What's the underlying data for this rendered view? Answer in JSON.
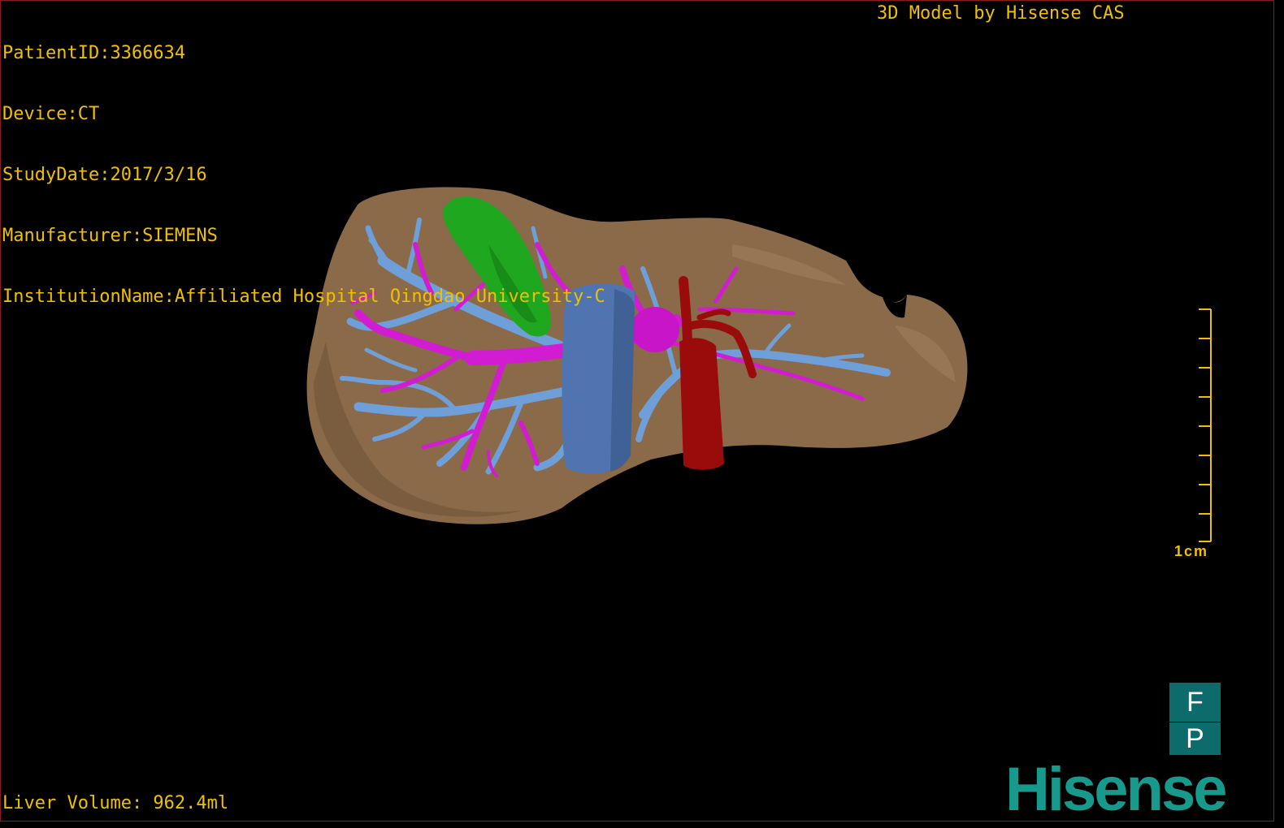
{
  "info": {
    "patient_id": "PatientID:3366634",
    "device": "Device:CT",
    "study_date": "StudyDate:2017/3/16",
    "manufacturer": "Manufacturer:SIEMENS",
    "institution": "InstitutionName:Affiliated Hospital Qingdao University-C"
  },
  "title": "3D Model by Hisense CAS",
  "liver_volume": "Liver Volume: 962.4ml",
  "scale_bar": {
    "label": "1cm",
    "ticks": 9
  },
  "orientation": {
    "top": "F",
    "bottom": "P"
  },
  "logo": "Hisense",
  "colors": {
    "text": "#f0c000",
    "liver": "#8a6a48",
    "gallbladder": "#1fa81f",
    "hepatic_vein": "#6f9fd8",
    "portal_vein": "#d21cd2",
    "ivc": "#4f74b0",
    "artery": "#9a0c0c",
    "logo": "#179a8c"
  }
}
